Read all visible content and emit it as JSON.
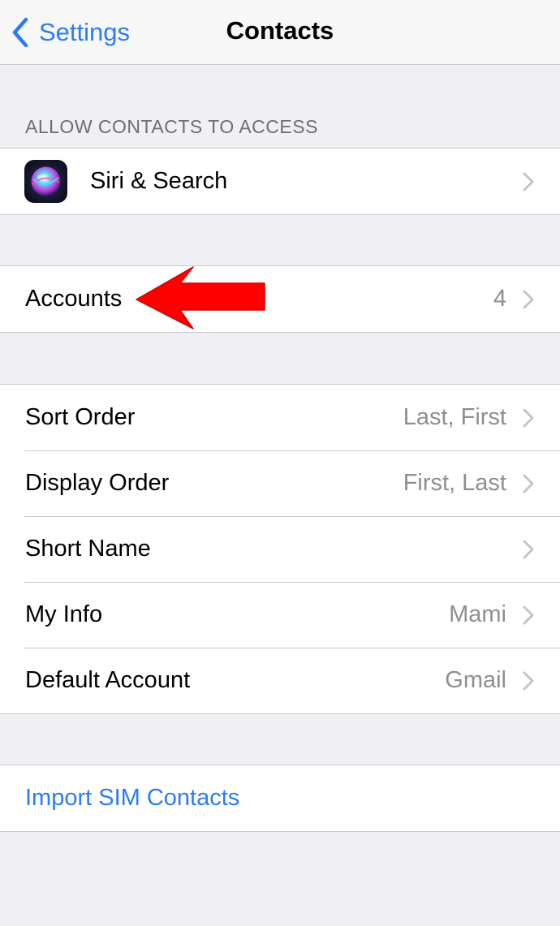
{
  "navbar": {
    "back_label": "Settings",
    "title": "Contacts"
  },
  "section_header": "ALLOW CONTACTS TO ACCESS",
  "siri": {
    "label": "Siri & Search",
    "icon": "siri-icon"
  },
  "accounts": {
    "label": "Accounts",
    "value": "4"
  },
  "settings_rows": [
    {
      "label": "Sort Order",
      "value": "Last, First"
    },
    {
      "label": "Display Order",
      "value": "First, Last"
    },
    {
      "label": "Short Name",
      "value": ""
    },
    {
      "label": "My Info",
      "value": "Mami"
    },
    {
      "label": "Default Account",
      "value": "Gmail"
    }
  ],
  "import": {
    "label": "Import SIM Contacts"
  },
  "annotation": {
    "icon": "red-arrow-icon",
    "color": "#ff0000"
  },
  "colors": {
    "accent": "#2b7cf6",
    "background": "#efeff4",
    "secondary_text": "#8e8e93",
    "separator": "#c8c7cc"
  }
}
